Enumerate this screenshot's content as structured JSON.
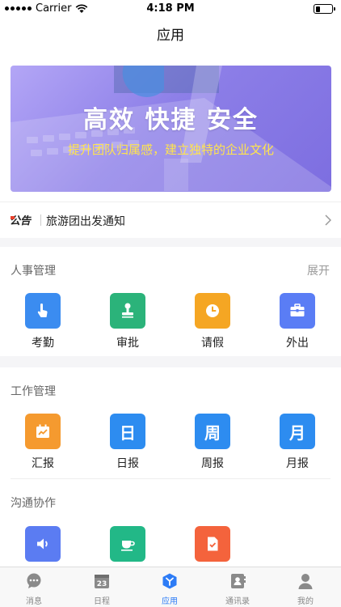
{
  "status_bar": {
    "carrier": "Carrier",
    "time": "4:18 PM"
  },
  "nav": {
    "title": "应用"
  },
  "banner": {
    "headline": "高效 快捷 安全",
    "subline": "提升团队归属感，建立独特的企业文化"
  },
  "notice": {
    "logo_text": "公告",
    "text": "旅游团出发通知"
  },
  "sections": {
    "hr": {
      "title": "人事管理",
      "expand_label": "展开",
      "apps": [
        {
          "label": "考勤",
          "icon": "tap-hand-icon",
          "color": "#3b8cf0"
        },
        {
          "label": "审批",
          "icon": "stamp-icon",
          "color": "#2bb37a"
        },
        {
          "label": "请假",
          "icon": "clock-icon",
          "color": "#f5a623"
        },
        {
          "label": "外出",
          "icon": "briefcase-icon",
          "color": "#5a7df5"
        }
      ]
    },
    "work": {
      "title": "工作管理",
      "apps": [
        {
          "label": "汇报",
          "icon": "report-calendar-icon",
          "color": "#f59a2f"
        },
        {
          "label": "日报",
          "icon": "daily-report-icon",
          "glyph": "日",
          "color": "#2d8cf0"
        },
        {
          "label": "周报",
          "icon": "weekly-report-icon",
          "glyph": "周",
          "color": "#2d8cf0"
        },
        {
          "label": "月报",
          "icon": "monthly-report-icon",
          "glyph": "月",
          "color": "#2d8cf0"
        }
      ]
    },
    "comm": {
      "title": "沟通协作",
      "apps": [
        {
          "icon": "speaker-icon",
          "color": "#5b7cf2"
        },
        {
          "icon": "coffee-cup-icon",
          "color": "#22b887"
        },
        {
          "icon": "document-check-icon",
          "color": "#f4633c"
        }
      ]
    }
  },
  "tabbar": {
    "items": [
      {
        "label": "消息",
        "icon": "chat-bubble-icon",
        "active": false
      },
      {
        "label": "日程",
        "icon": "calendar-icon",
        "badge": "23",
        "active": false
      },
      {
        "label": "应用",
        "icon": "apps-cube-icon",
        "active": true
      },
      {
        "label": "通讯录",
        "icon": "contacts-book-icon",
        "active": false
      },
      {
        "label": "我的",
        "icon": "user-profile-icon",
        "active": false
      }
    ],
    "active_color": "#2d7cf6",
    "inactive_color": "#888888"
  }
}
